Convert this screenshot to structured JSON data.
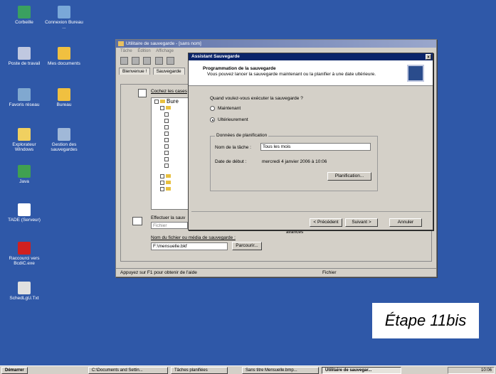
{
  "desktop": {
    "icons": [
      {
        "label": "Corbeille",
        "icon": "recycle-bin-icon",
        "color": "#3aa060"
      },
      {
        "label": "Connexion Bureau ...",
        "icon": "remote-desktop-icon",
        "color": "#7aa8d8"
      },
      {
        "label": "Poste de travail",
        "icon": "computer-icon",
        "color": "#c0c8e0"
      },
      {
        "label": "Mes documents",
        "icon": "documents-folder-icon",
        "color": "#f0c040"
      },
      {
        "label": "Favoris réseau",
        "icon": "network-icon",
        "color": "#80a8d0"
      },
      {
        "label": "Bureau",
        "icon": "folder-icon",
        "color": "#f0c040"
      },
      {
        "label": "Explorateur Windows",
        "icon": "explorer-icon",
        "color": "#f0d060"
      },
      {
        "label": "Gestion des sauvegardes",
        "icon": "backup-manager-icon",
        "color": "#a0b8d8"
      },
      {
        "label": "Java",
        "icon": "java-icon",
        "color": "#40a050"
      },
      {
        "label": "TADE (Serveur)",
        "icon": "tade-server-icon",
        "color": "#ffffff"
      },
      {
        "label": "Raccourci vers BcdiC.exe",
        "icon": "bcdi-icon",
        "color": "#d02020"
      },
      {
        "label": "SchedLgU.Txt",
        "icon": "text-file-icon",
        "color": "#e0e0e0"
      }
    ]
  },
  "main_window": {
    "title": "Utilitaire de sauvegarde - [sans nom]",
    "menu": [
      "Tâche",
      "Édition",
      "Affichage"
    ],
    "tabs": [
      "Bienvenue !",
      "Sauvegarde"
    ],
    "tree_caption": "Cochez les cases",
    "tree_root": "Bure",
    "status_left": "Appuyez sur F1 pour obtenir de l'aide",
    "status_right": "Fichier",
    "dest_label": "Effectuer la sauv",
    "dest_value": "Fichier",
    "media_label": "Nom du fichier ou média de sauvegarde :",
    "media_value": "F:\\mensuelle.bkf",
    "browse_label": "Parcourir...",
    "options_text": "avancés"
  },
  "wizard": {
    "title": "Assistant Sauvegarde",
    "heading": "Programmation de la sauvegarde",
    "subheading": "Vous pouvez lancer la sauvegarde maintenant ou la planifier à une date ultérieure.",
    "question": "Quand voulez-vous exécuter la sauvegarde ?",
    "options": [
      {
        "label": "Maintenant",
        "selected": false
      },
      {
        "label": "Ultérieurement",
        "selected": true
      }
    ],
    "group_label": "Données de planification",
    "task_name_label": "Nom de la tâche :",
    "task_name_value": "Tous les mois",
    "start_date_label": "Date de début :",
    "start_date_value": "mercredi 4 janvier 2006 à 10:06",
    "schedule_button": "Planification...",
    "back_button": "< Précédent",
    "next_button": "Suivant >",
    "cancel_button": "Annuler"
  },
  "step_label": "Étape 11bis",
  "taskbar": {
    "start": "Démarrer",
    "tasks": [
      "C:\\Documents and Settin...",
      "Tâches planifiées",
      "Sans titre Mensuelle.bmp...",
      "Utilitaire de sauvegar..."
    ],
    "clock": "10:06"
  }
}
